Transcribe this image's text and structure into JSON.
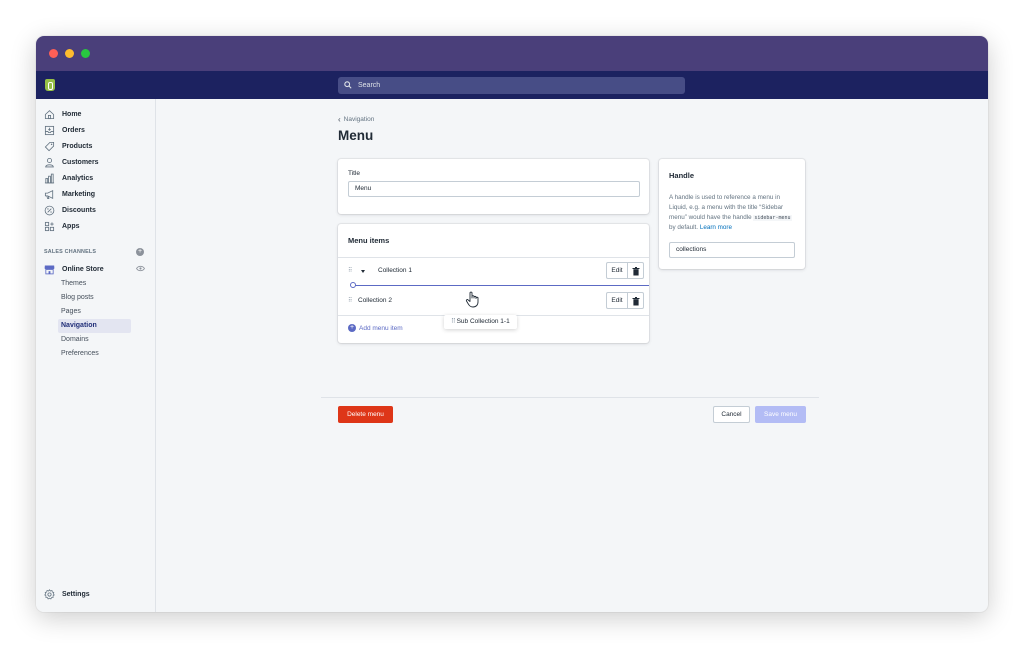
{
  "search": {
    "placeholder": "Search"
  },
  "sidebar": {
    "items": [
      {
        "label": "Home",
        "icon": "home-icon"
      },
      {
        "label": "Orders",
        "icon": "orders-icon"
      },
      {
        "label": "Products",
        "icon": "tag-icon"
      },
      {
        "label": "Customers",
        "icon": "person-icon"
      },
      {
        "label": "Analytics",
        "icon": "bar-chart-icon"
      },
      {
        "label": "Marketing",
        "icon": "megaphone-icon"
      },
      {
        "label": "Discounts",
        "icon": "discount-icon"
      },
      {
        "label": "Apps",
        "icon": "apps-icon"
      }
    ],
    "sales_channels_heading": "SALES CHANNELS",
    "online_store": "Online Store",
    "sub_items": [
      "Themes",
      "Blog posts",
      "Pages",
      "Navigation",
      "Domains",
      "Preferences"
    ],
    "active_sub_item": "Navigation",
    "settings": "Settings"
  },
  "breadcrumb": {
    "back_label": "Navigation"
  },
  "page": {
    "title": "Menu"
  },
  "title_card": {
    "label": "Title",
    "value": "Menu"
  },
  "menu_items_card": {
    "heading": "Menu items",
    "items": [
      {
        "label": "Collection 1",
        "edit": "Edit"
      },
      {
        "label": "Collection 2",
        "edit": "Edit"
      }
    ],
    "dragging_item": "Sub Collection 1-1",
    "add_item": "Add menu item"
  },
  "handle_card": {
    "heading": "Handle",
    "desc_part1": "A handle is used to reference a menu in Liquid, e.g. a menu with the title “Sidebar menu” would have the handle",
    "desc_code": "sidebar-menu",
    "desc_part2": "by default.",
    "learn_more": "Learn more",
    "value": "collections"
  },
  "actions": {
    "delete": "Delete menu",
    "cancel": "Cancel",
    "save": "Save menu"
  },
  "colors": {
    "titlebar": "#4a3f7a",
    "topbar": "#1c2260",
    "accent": "#5c6ac4",
    "destructive": "#de3618",
    "save_disabled": "#b3bcf5"
  }
}
